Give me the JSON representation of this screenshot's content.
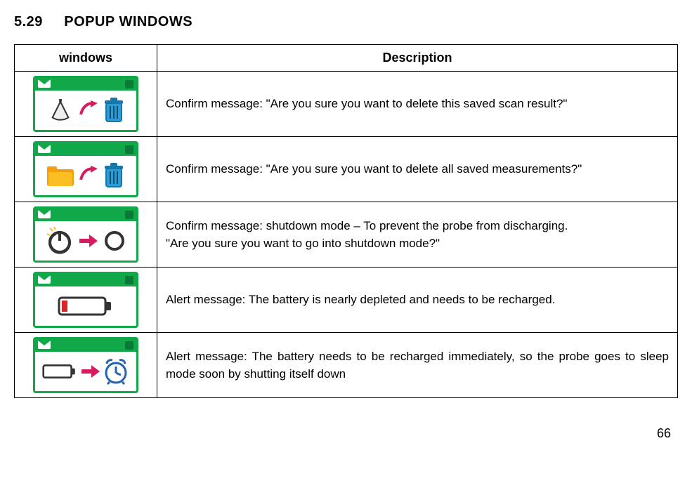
{
  "section": {
    "number": "5.29",
    "title": "POPUP WINDOWS"
  },
  "headers": {
    "windows": "windows",
    "description": "Description"
  },
  "rows": [
    {
      "desc": "Confirm message: \"Are you sure you want to delete this saved scan result?\""
    },
    {
      "desc": "Confirm message: \"Are you sure you want to delete all saved measurements?\""
    },
    {
      "desc": "Confirm message: shutdown mode – To prevent the probe from discharging.\n  \"Are you sure you want to go into shutdown mode?\""
    },
    {
      "desc": "Alert message: The battery is nearly depleted and needs to be recharged."
    },
    {
      "desc": "Alert message: The battery needs to be recharged immediately, so the probe goes to sleep mode soon by shutting itself down"
    }
  ],
  "page_number": "66"
}
